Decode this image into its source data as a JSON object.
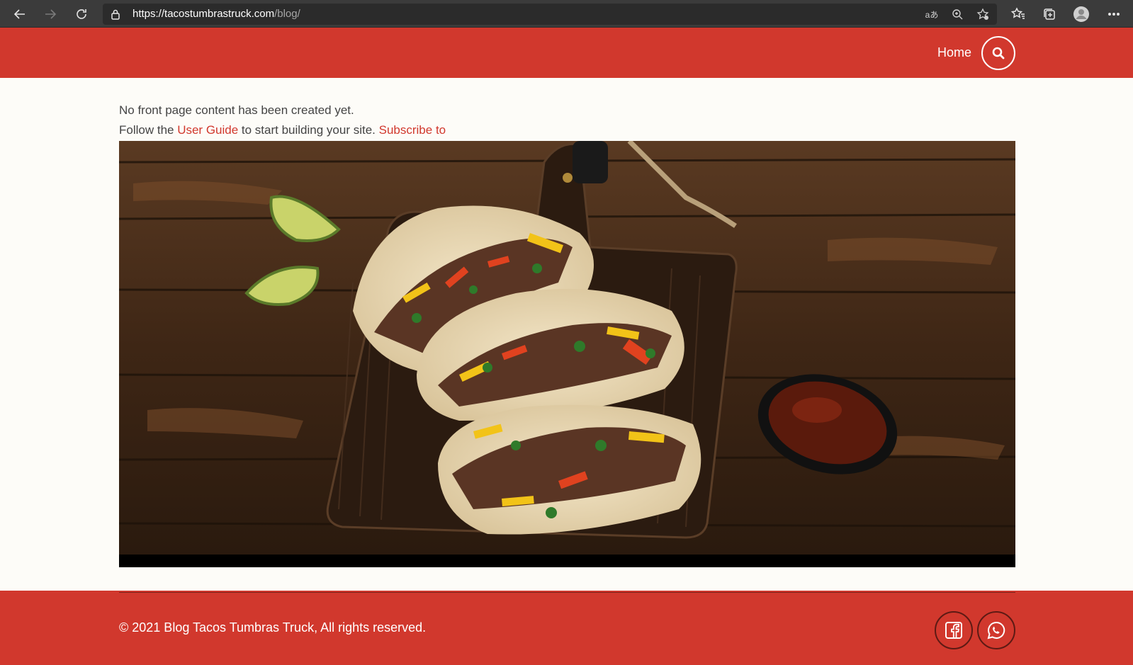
{
  "browser": {
    "url_host": "https://tacostumbrastruck.com",
    "url_path": "/blog/",
    "icons": [
      "back-icon",
      "forward-icon",
      "refresh-icon",
      "lock-icon",
      "read-aloud-icon",
      "zoom-icon",
      "add-favorite-icon",
      "favorites-icon",
      "collections-icon",
      "profile-icon",
      "more-icon"
    ]
  },
  "header": {
    "nav": [
      {
        "label": "Home"
      }
    ],
    "search_icon": "search-icon",
    "colors": {
      "brand": "#d1382d"
    }
  },
  "main": {
    "message_line1": "No front page content has been created yet.",
    "message_line2_prefix": "Follow the ",
    "user_guide_link": "User Guide",
    "message_line2_middle": " to start building your site. ",
    "subscribe_link": "Subscribe to",
    "hero_image": "tacos-on-wooden-board"
  },
  "footer": {
    "copyright": "© 2021 Blog Tacos Tumbras Truck, All rights reserved.",
    "social": [
      "facebook-icon",
      "whatsapp-icon"
    ]
  }
}
